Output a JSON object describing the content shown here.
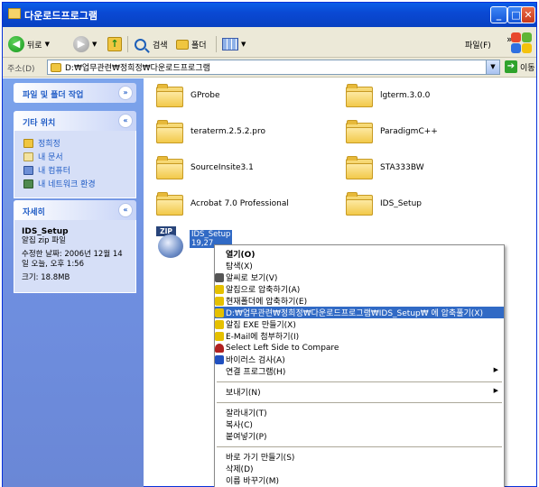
{
  "window": {
    "title": "다운로드프로그램",
    "min_glyph": "_",
    "max_glyph": "□",
    "close_glyph": "✕"
  },
  "toolbar": {
    "back_label": "뒤로",
    "search_label": "검색",
    "folders_label": "폴더",
    "file_menu": "파일(F)",
    "chevron": "»"
  },
  "address": {
    "label": "주소(D)",
    "path": "D:₩업무관련₩정희정₩다운로드프로그램",
    "go_label": "이동"
  },
  "taskpane": {
    "file_tasks_title": "파일 및 폴더 작업",
    "other_places_title": "기타 위치",
    "other_places": [
      {
        "label": "정희정",
        "icon": "folder-icon",
        "color": "#f0c640"
      },
      {
        "label": "내 문서",
        "icon": "documents-icon",
        "color": "#f3e3a0"
      },
      {
        "label": "내 컴퓨터",
        "icon": "computer-icon",
        "color": "#6d8fd6"
      },
      {
        "label": "내 네트워크 환경",
        "icon": "network-icon",
        "color": "#4f8a4f"
      }
    ],
    "details_title": "자세히",
    "details": {
      "name": "IDS_Setup",
      "type": "알집 zip 파일",
      "modified_line1": "수정한 날짜: 2006년 12월 14",
      "modified_line2": "일 오늘, 오후 1:56",
      "size": "크기: 18.8MB"
    }
  },
  "files": [
    {
      "name": "GProbe"
    },
    {
      "name": "lgterm.3.0.0"
    },
    {
      "name": "teraterm.2.5.2.pro"
    },
    {
      "name": "ParadigmC++"
    },
    {
      "name": "SourceInsite3.1"
    },
    {
      "name": "STA333BW"
    },
    {
      "name": "Acrobat 7.0 Professional"
    },
    {
      "name": "IDS_Setup"
    }
  ],
  "zip_file": {
    "badge": "ZIP",
    "name": "IDS_Setup",
    "size": "19,27"
  },
  "context_menu": {
    "items": [
      {
        "label": "열기(O)",
        "bold": true
      },
      {
        "label": "탐색(X)"
      },
      {
        "label": "알씨로 보기(V)",
        "icon_color": "#555555"
      },
      {
        "label": "알집으로 압축하기(A)",
        "icon_color": "#e5c000"
      },
      {
        "label": "현재폴더에 압축하기(E)",
        "icon_color": "#e5c000"
      },
      {
        "label": "D:₩업무관련₩정희정₩다운로드프로그램₩IDS_Setup₩ 에 압축풀기(X)",
        "icon_color": "#e5c000",
        "highlight": true
      },
      {
        "label": "알집 EXE 만들기(X)",
        "icon_color": "#e5c000"
      },
      {
        "label": "E-Mail에 첨부하기(I)",
        "icon_color": "#e5c000"
      },
      {
        "label": "Select Left Side to Compare",
        "icon_color": "#b02020"
      },
      {
        "label": "바이러스 검사(A)",
        "icon_color": "#2050c0"
      },
      {
        "label": "연결 프로그램(H)",
        "submenu": true
      },
      {
        "label": "보내기(N)",
        "submenu": true
      },
      {
        "label": "잘라내기(T)"
      },
      {
        "label": "복사(C)"
      },
      {
        "label": "붙여넣기(P)"
      },
      {
        "label": "바로 가기 만들기(S)"
      },
      {
        "label": "삭제(D)"
      },
      {
        "label": "이름 바꾸기(M)"
      }
    ]
  }
}
